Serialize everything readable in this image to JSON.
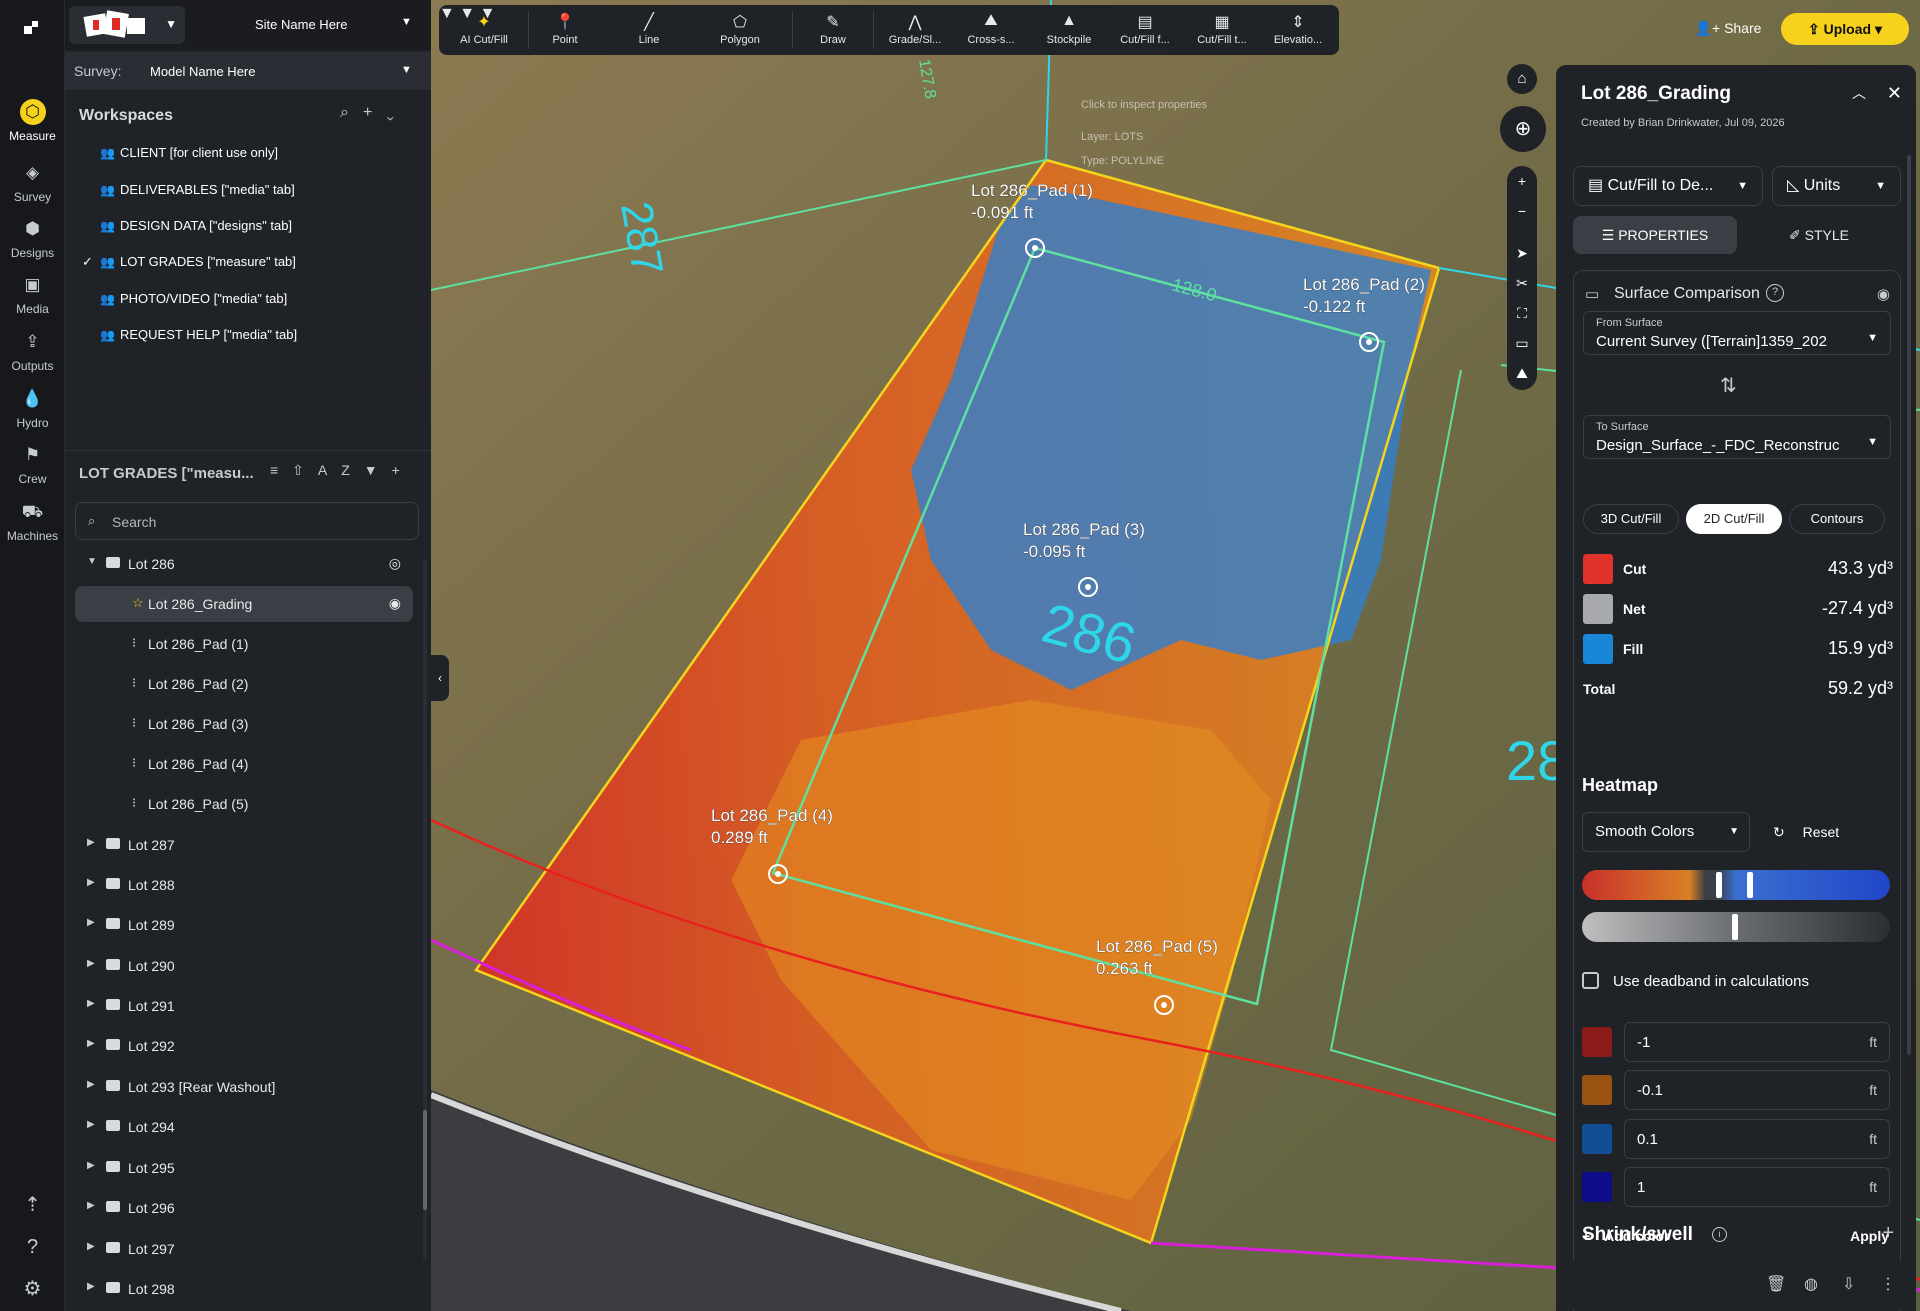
{
  "rail": {
    "items": [
      {
        "label": "Measure",
        "icon": "measure-icon"
      },
      {
        "label": "Survey",
        "icon": "survey-icon"
      },
      {
        "label": "Designs",
        "icon": "designs-icon"
      },
      {
        "label": "Media",
        "icon": "media-icon"
      },
      {
        "label": "Outputs",
        "icon": "outputs-icon"
      },
      {
        "label": "Hydro",
        "icon": "hydro-icon"
      },
      {
        "label": "Crew",
        "icon": "crew-icon"
      },
      {
        "label": "Machines",
        "icon": "machines-icon"
      }
    ]
  },
  "header": {
    "site_name": "Site Name Here",
    "survey_label": "Survey:",
    "model_name": "Model Name Here"
  },
  "workspaces": {
    "title": "Workspaces",
    "items": [
      {
        "label": "CLIENT [for client use only]",
        "checked": false
      },
      {
        "label": "DELIVERABLES [\"media\" tab]",
        "checked": false
      },
      {
        "label": "DESIGN DATA [\"designs\" tab]",
        "checked": false
      },
      {
        "label": "LOT GRADES [\"measure\" tab]",
        "checked": true
      },
      {
        "label": "PHOTO/VIDEO [\"media\" tab]",
        "checked": false
      },
      {
        "label": "REQUEST HELP [\"media\" tab]",
        "checked": false
      }
    ]
  },
  "layers": {
    "title": "LOT GRADES [\"measu...",
    "search_placeholder": "Search",
    "expanded_group": "Lot 286",
    "selected": "Lot 286_Grading",
    "children": [
      "Lot 286_Pad (1)",
      "Lot 286_Pad (2)",
      "Lot 286_Pad (3)",
      "Lot 286_Pad (4)",
      "Lot 286_Pad (5)"
    ],
    "groups": [
      "Lot 287",
      "Lot 288",
      "Lot 289",
      "Lot 290",
      "Lot 291",
      "Lot 292",
      "Lot 293 [Rear Washout]",
      "Lot 294",
      "Lot 295",
      "Lot 296",
      "Lot 297",
      "Lot 298"
    ]
  },
  "toolbar": {
    "tools": [
      "AI Cut/Fill",
      "Point",
      "Line",
      "Polygon",
      "Draw",
      "Grade/Sl...",
      "Cross-s...",
      "Stockpile",
      "Cut/Fill f...",
      "Cut/Fill t...",
      "Elevatio..."
    ],
    "share": "Share",
    "upload": "Upload"
  },
  "map": {
    "lot_labels": [
      "287",
      "286",
      "28"
    ],
    "dimension_labels": [
      "128.0",
      "127.8"
    ],
    "tooltip": [
      "Click to inspect properties",
      "Layer: LOTS",
      "Type: POLYLINE"
    ],
    "pads": [
      {
        "name": "Lot 286_Pad (1)",
        "value": "-0.091 ft"
      },
      {
        "name": "Lot 286_Pad (2)",
        "value": "-0.122 ft"
      },
      {
        "name": "Lot 286_Pad (3)",
        "value": "-0.095 ft"
      },
      {
        "name": "Lot 286_Pad (4)",
        "value": "0.289 ft"
      },
      {
        "name": "Lot 286_Pad (5)",
        "value": "0.263 ft"
      }
    ]
  },
  "panel": {
    "title": "Lot 286_Grading",
    "subtitle": "Created by Brian Drinkwater, Jul 09, 2026",
    "mode_select": "Cut/Fill to De...",
    "units_select": "Units",
    "tab_properties": "PROPERTIES",
    "tab_style": "STYLE",
    "surface_comparison": "Surface Comparison",
    "from_label": "From Surface",
    "from_value": "Current Survey ([Terrain]1359_202",
    "to_label": "To Surface",
    "to_value": "Design_Surface_-_FDC_Reconstruc",
    "views": [
      "3D Cut/Fill",
      "2D Cut/Fill",
      "Contours"
    ],
    "volumes": [
      {
        "label": "Cut",
        "value": "43.3 yd³",
        "color": "#e0312b"
      },
      {
        "label": "Net",
        "value": "-27.4 yd³",
        "color": "#a7a9ac"
      },
      {
        "label": "Fill",
        "value": "15.9 yd³",
        "color": "#1a86d8"
      },
      {
        "label": "Total",
        "value": "59.2 yd³",
        "color": ""
      }
    ],
    "heatmap_title": "Heatmap",
    "heatmap_style": "Smooth Colors",
    "reset": "Reset",
    "deadband": "Use deadband in calculations",
    "breaks": [
      {
        "value": "-1",
        "unit": "ft",
        "color": "#8b1a1a"
      },
      {
        "value": "-0.1",
        "unit": "ft",
        "color": "#9a5210"
      },
      {
        "value": "0.1",
        "unit": "ft",
        "color": "#114e93"
      },
      {
        "value": "1",
        "unit": "ft",
        "color": "#0d0d8a"
      }
    ],
    "add_color": "Add color",
    "apply": "Apply",
    "shrink_swell": "Shrink/swell"
  }
}
